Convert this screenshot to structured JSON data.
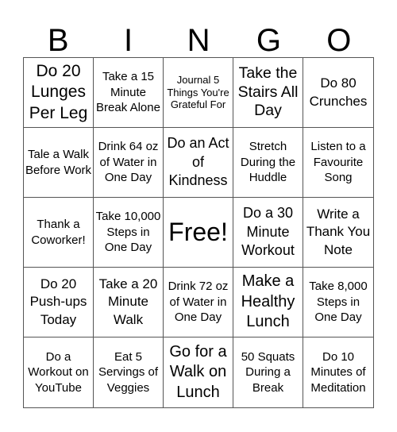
{
  "title_letters": [
    "B",
    "I",
    "N",
    "G",
    "O"
  ],
  "cells": [
    "Do 20 Lunges Per Leg",
    "Take a 15 Minute Break Alone",
    "Journal 5 Things You're Grateful For",
    "Take the Stairs All Day",
    "Do 80 Crunches",
    "Tale a Walk Before Work",
    "Drink 64 oz of Water in One Day",
    "Do an Act of Kindness",
    "Stretch During the Huddle",
    "Listen to a Favourite Song",
    "Thank a Coworker!",
    "Take 10,000 Steps in One Day",
    "Free!",
    "Do a 30 Minute Workout",
    "Write a Thank You Note",
    "Do 20 Push-ups Today",
    "Take a 20 Minute Walk",
    "Drink 72 oz of Water in One Day",
    "Make a Healthy Lunch",
    "Take 8,000 Steps in One Day",
    "Do a Workout on YouTube",
    "Eat 5 Servings of Veggies",
    "Go for a Walk on Lunch",
    "50 Squats During a Break",
    "Do 10 Minutes of Meditation"
  ],
  "colors": {
    "text": "#000000",
    "grid_line": "#555555",
    "background": "#ffffff"
  }
}
